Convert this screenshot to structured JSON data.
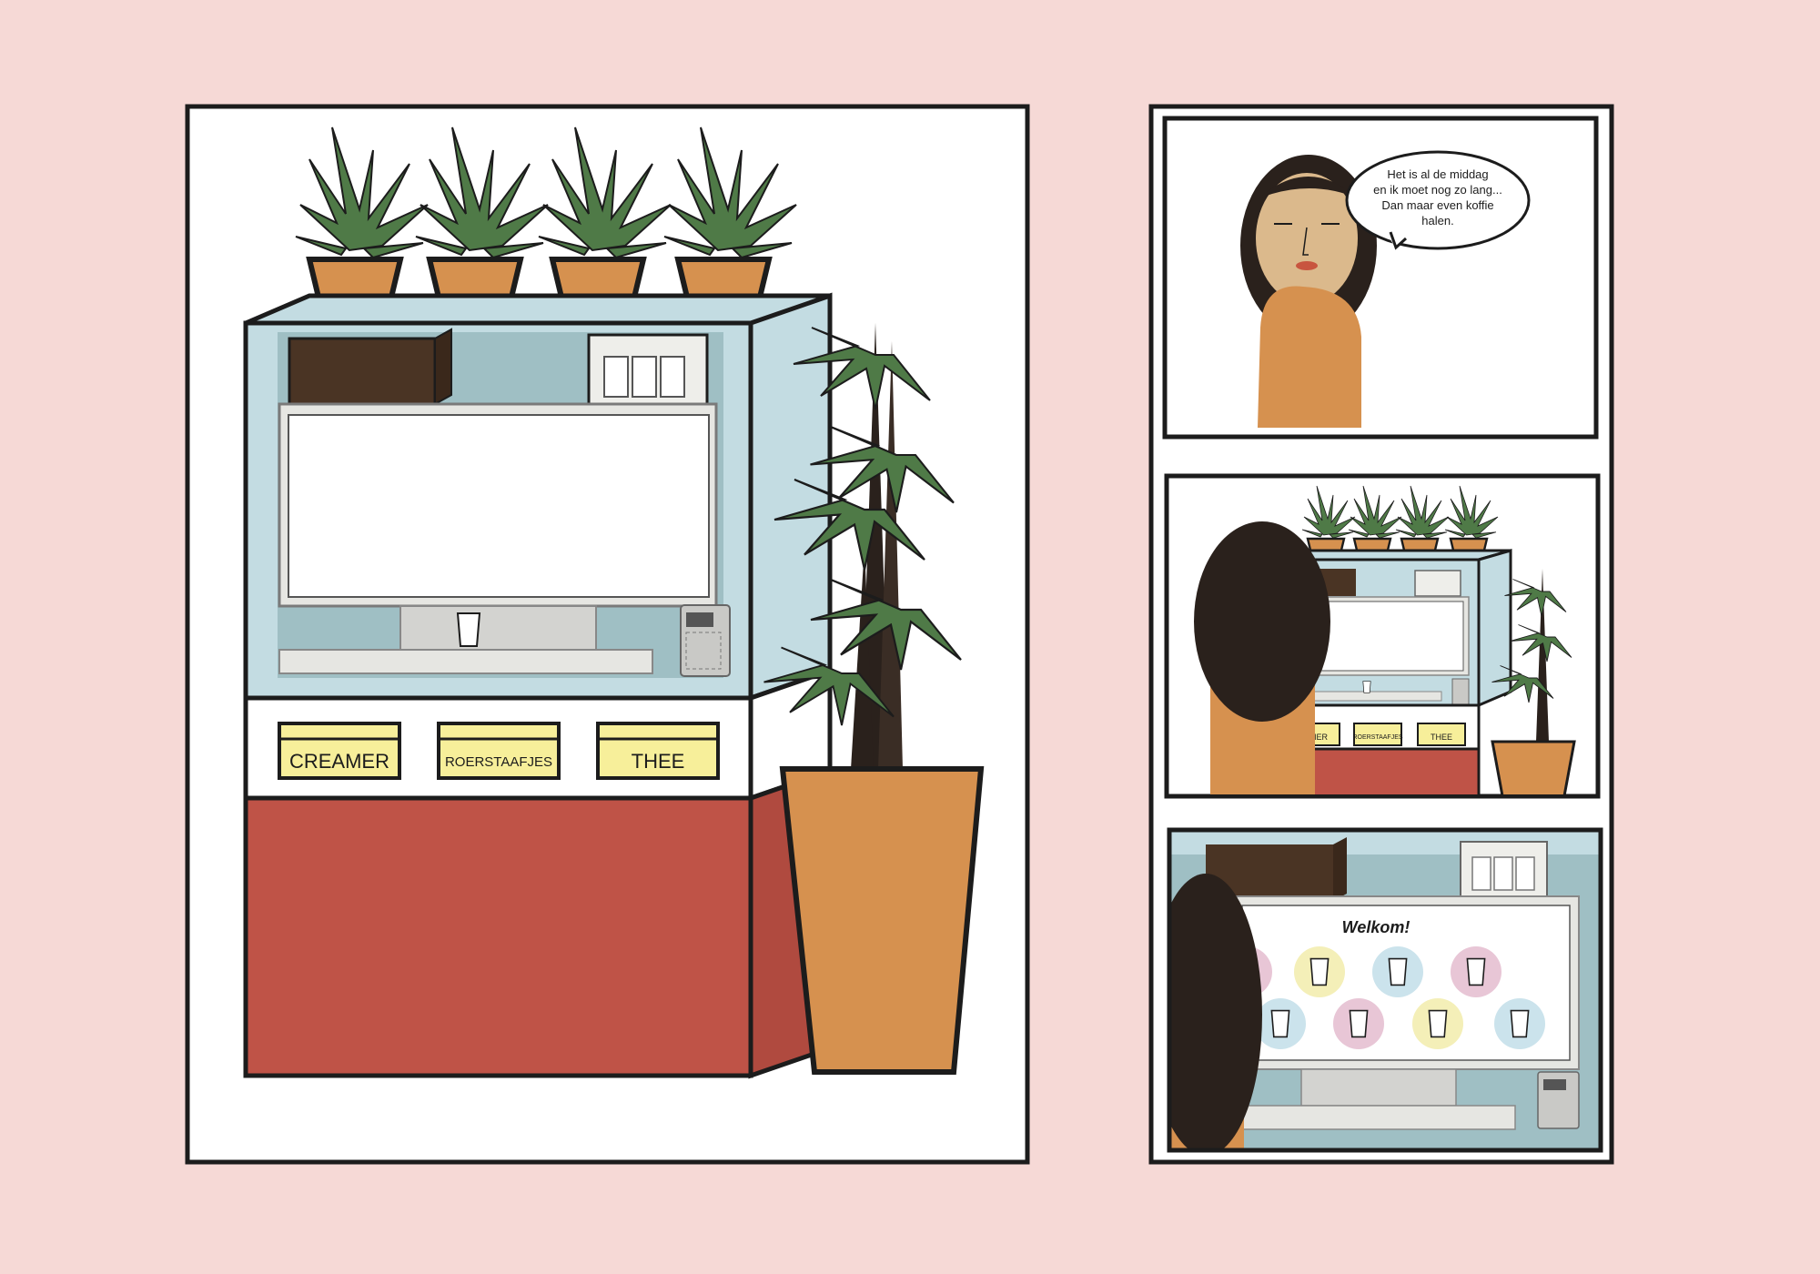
{
  "colors": {
    "page_bg": "#f6d9d6",
    "panel_bg": "#ffffff",
    "glass": "#c3dce2",
    "glass_inner": "#9fbfc4",
    "counter_red": "#bf5347",
    "pot_orange": "#d6914f",
    "leaf_green": "#4f7a47",
    "hair": "#2a211c",
    "skin": "#dbb98c",
    "shirt": "#d6914f",
    "label_yellow": "#f7ef9a",
    "brown_box": "#4a3424"
  },
  "labels": {
    "creamer": "CREAMER",
    "roerstaafjes": "ROERSTAAFJES",
    "thee": "THEE",
    "creamer_small": "AMER",
    "roerstaafjes_small": "ROERSTAAFJES",
    "thee_small": "THEE"
  },
  "speech": {
    "line1": "Het is al de middag",
    "line2": "en ik moet nog zo lang...",
    "line3": "Dan maar even koffie",
    "line4": "halen."
  },
  "screen": {
    "welcome": "Welkom!"
  },
  "icons": {
    "plant": "plant-icon",
    "cup": "cup-icon",
    "payment_terminal": "payment-terminal-icon"
  }
}
